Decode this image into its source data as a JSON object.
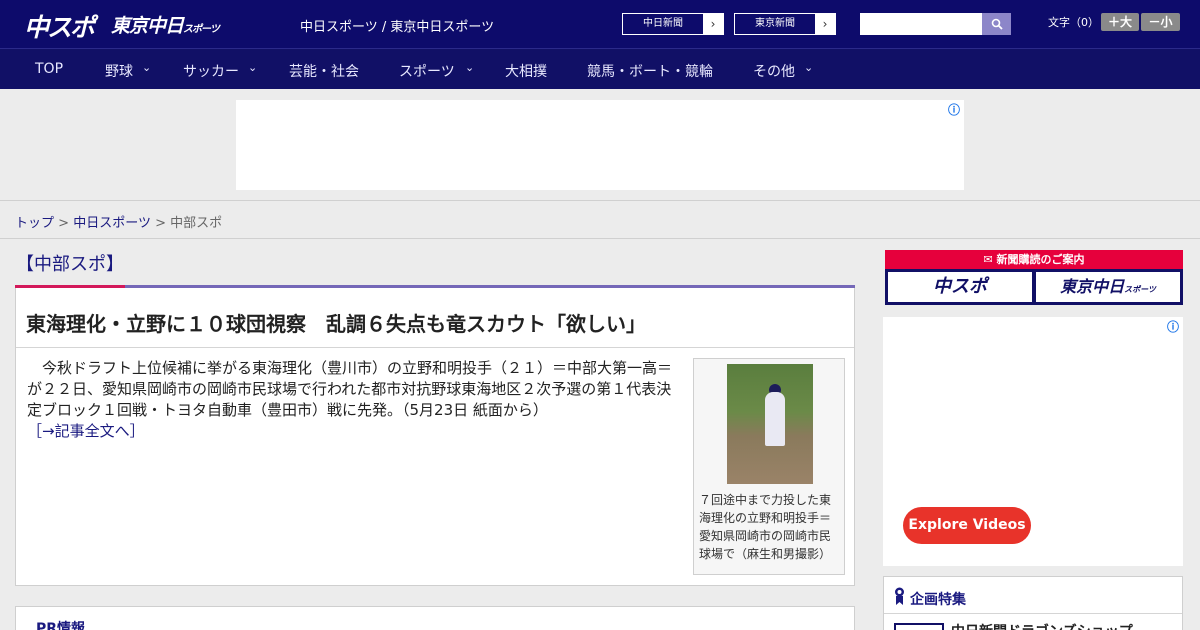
{
  "header": {
    "logo_chunichi": "中スポ",
    "logo_tokyo": "東京中日",
    "logo_tokyo_small": "スポーツ",
    "title": "中日スポーツ / 東京中日スポーツ",
    "site_buttons": [
      {
        "label": "中日新聞"
      },
      {
        "label": "東京新聞"
      }
    ],
    "search_placeholder": "",
    "font_size_label": "文字（0）",
    "font_bigger": "＋大",
    "font_smaller": "－小"
  },
  "nav": {
    "items": [
      "TOP",
      "野球",
      "サッカー",
      "芸能・社会",
      "スポーツ",
      "大相撲",
      "競馬・ボート・競輪",
      "その他"
    ]
  },
  "breadcrumb": {
    "home": "トップ",
    "section": "中日スポーツ",
    "current": "中部スポ",
    "sep": ">"
  },
  "article": {
    "category": "【中部スポ】",
    "title": "東海理化・立野に１０球団視察　乱調６失点も竜スカウト「欲しい」",
    "body": "　今秋ドラフト上位候補に挙がる東海理化（豊川市）の立野和明投手（２１）＝中部大第一高＝が２２日、愛知県岡崎市の岡崎市民球場で行われた都市対抗野球東海地区２次予選の第１代表決定ブロック１回戦・トヨタ自動車（豊田市）戦に先発。（5月23日 紙面から）",
    "more_link": "［→記事全文へ］",
    "photo_caption": "７回途中まで力投した東海理化の立野和明投手＝愛知県岡崎市の岡崎市民球場で（麻生和男撮影）"
  },
  "pr": {
    "title": "PR情報"
  },
  "sidebar": {
    "subscribe_title": "新聞購読のご案内",
    "subscribe_chunichi": "中スポ",
    "subscribe_tokyo": "東京中日",
    "subscribe_tokyo_small": "スポーツ",
    "ad_button": "Explore Videos",
    "feature_title": "企画特集",
    "feature_item": "中日新聞ドラゴンズショップ"
  },
  "icons": {
    "ad_info": "ⓘ",
    "chevron": "⌄",
    "arrow": "›"
  }
}
